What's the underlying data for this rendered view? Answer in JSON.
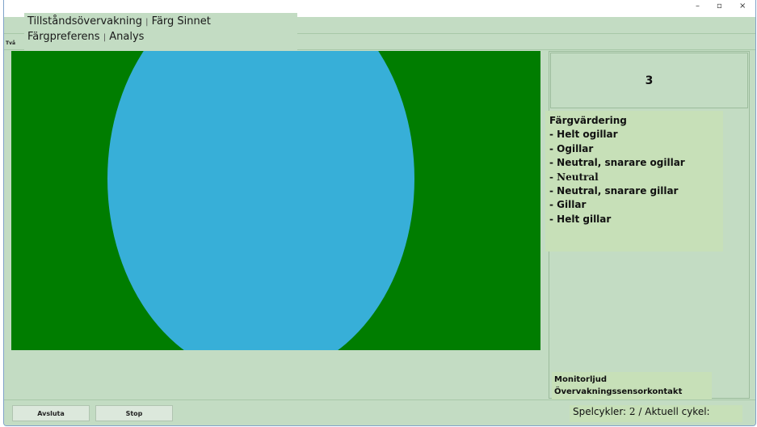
{
  "window": {
    "controls": {
      "minimize": "–",
      "maximize": "▫",
      "close": "×"
    },
    "corner_label": "Två"
  },
  "overlay": {
    "line1_a": "Tillståndsövervakning",
    "line1_sep": "|",
    "line1_b": "Färg Sinnet",
    "line2_a": "Färgpreferens",
    "line2_sep": "|",
    "line2_b": "Analys"
  },
  "stimulus": {
    "background_color": "#007d00",
    "circle_color": "#37afd8"
  },
  "counter": {
    "value": "3"
  },
  "rating": {
    "title": "Färgvärdering",
    "options": [
      "- Helt ogillar",
      "- Ogillar",
      "- Neutral, snarare ogillar",
      "- Neutral",
      "- Neutral, snarare gillar",
      "- Gillar",
      "- Helt gillar"
    ]
  },
  "monitor": {
    "line1": "Monitorljud",
    "line2": "Övervakningssensorkontakt"
  },
  "buttons": {
    "quit": "Avsluta",
    "stop": "Stop"
  },
  "status": {
    "cycles_label": "Spelcykler:",
    "cycles_value": "2",
    "sep": "/",
    "current_label": "Aktuell cykel:"
  }
}
